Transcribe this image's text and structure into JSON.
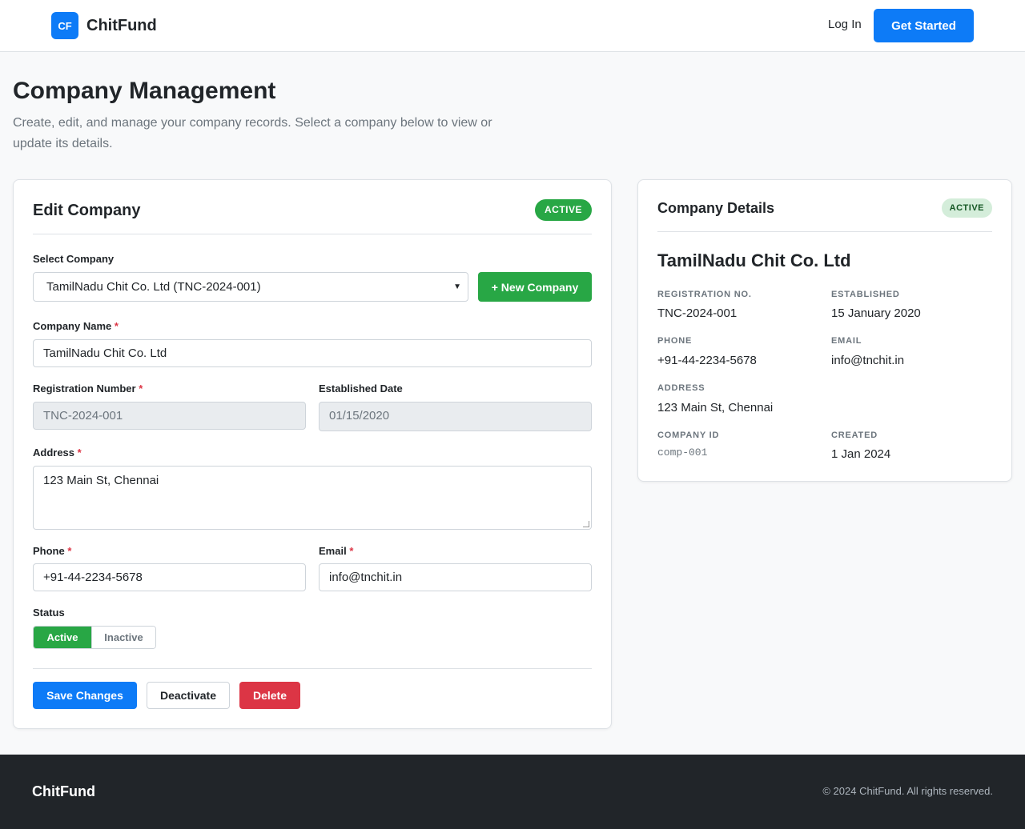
{
  "header": {
    "logo_text": "CF",
    "brand": "ChitFund",
    "login": "Log In",
    "get_started": "Get Started"
  },
  "page": {
    "title": "Company Management",
    "description": "Create, edit, and manage your company records. Select a company below to view or update its details."
  },
  "edit": {
    "title": "Edit Company",
    "status_badge": "ACTIVE",
    "select_label": "Select Company",
    "selected_company": "TamilNadu Chit Co. Ltd (TNC-2024-001)",
    "new_company": "+ New Company",
    "name_label": "Company Name",
    "name_value": "TamilNadu Chit Co. Ltd",
    "reg_label": "Registration Number",
    "reg_value": "TNC-2024-001",
    "est_label": "Established Date",
    "est_value": "01/15/2020",
    "address_label": "Address",
    "address_value": "123 Main St, Chennai",
    "phone_label": "Phone",
    "phone_value": "+91-44-2234-5678",
    "email_label": "Email",
    "email_value": "info@tnchit.in",
    "status_label": "Status",
    "status_active": "Active",
    "status_inactive": "Inactive",
    "required_mark": "*",
    "save": "Save Changes",
    "deactivate": "Deactivate",
    "delete": "Delete"
  },
  "details": {
    "title": "Company Details",
    "status_badge": "ACTIVE",
    "company_name": "TamilNadu Chit Co. Ltd",
    "reg_label": "REGISTRATION NO.",
    "reg_value": "TNC-2024-001",
    "est_label": "ESTABLISHED",
    "est_value": "15 January 2020",
    "phone_label": "PHONE",
    "phone_value": "+91-44-2234-5678",
    "email_label": "EMAIL",
    "email_value": "info@tnchit.in",
    "address_label": "ADDRESS",
    "address_value": "123 Main St, Chennai",
    "id_label": "COMPANY ID",
    "id_value": "comp-001",
    "created_label": "CREATED",
    "created_value": "1 Jan 2024"
  },
  "footer": {
    "brand": "ChitFund",
    "copyright": "© 2024 ChitFund. All rights reserved."
  },
  "colors": {
    "primary": "#0d7bf7",
    "success": "#28a745",
    "danger": "#dc3545",
    "footer_bg": "#212529"
  }
}
